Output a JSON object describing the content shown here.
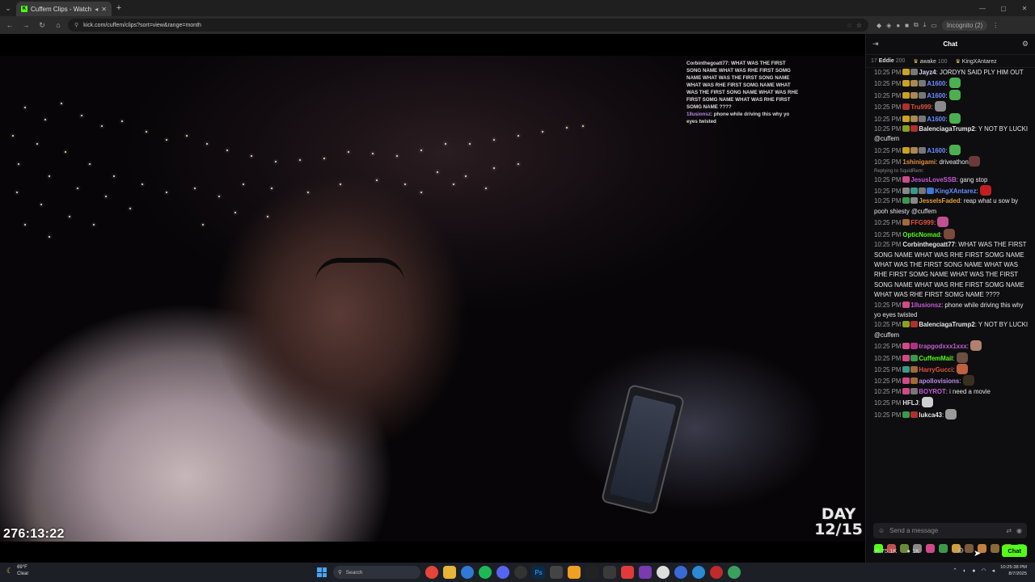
{
  "browser": {
    "tab_title": "Cuffem Clips - Watch Live ...",
    "new_tab": "+",
    "url": "kick.com/cuffem/clips?sort=view&range=month",
    "incognito_label": "Incognito (2)"
  },
  "video": {
    "overlay_chat": [
      {
        "user": "Corbinthegoatt77",
        "text": "WHAT WAS THE FIRST SONG NAME WHAT WAS RHE FIRST SOMG NAME WHAT WAS THE FIRST SONG NAME WHAT WAS RHE FIRST SOMG NAME WHAT WAS THE FIRST SONG NAME WHAT WAS RHE FIRST SOMG NAME WHAT WAS RHE FIRST SOMG NAME ????"
      },
      {
        "user": "1llusionsz",
        "text": "phone while driving this why yo eyes twisted"
      }
    ],
    "timer": "276:13:22",
    "day_line1": "DAY",
    "day_line2": "12/15"
  },
  "chat": {
    "header_title": "Chat",
    "leaderboard": [
      {
        "prefix": "17",
        "name": "Eddie",
        "amount": "200"
      },
      {
        "name": "awake",
        "amount": "100"
      },
      {
        "name": "KingXAntarez",
        "amount": ""
      }
    ],
    "messages": [
      {
        "time": "10:25 PM",
        "user": "Jayz4",
        "color": "#d9d1f0",
        "text": "JORDYN SAID PLY HIM OUT",
        "badges": [
          "#c9a227",
          "#777"
        ],
        "emote": null
      },
      {
        "time": "10:25 PM",
        "user": "A1600",
        "color": "#6a8cff",
        "text": "",
        "badges": [
          "#c9a227",
          "#aa8855",
          "#777"
        ],
        "emote": "#4caf50"
      },
      {
        "time": "10:25 PM",
        "user": "A1600",
        "color": "#6a8cff",
        "text": "",
        "badges": [
          "#c9a227",
          "#aa8855",
          "#777"
        ],
        "emote": "#4caf50"
      },
      {
        "time": "10:25 PM",
        "user": "Tru999",
        "color": "#e0533b",
        "text": "",
        "badges": [
          "#b03030"
        ],
        "emote": "#8a8a8a"
      },
      {
        "time": "10:25 PM",
        "user": "A1600",
        "color": "#6a8cff",
        "text": "",
        "badges": [
          "#c9a227",
          "#aa8855",
          "#777"
        ],
        "emote": "#4caf50"
      },
      {
        "time": "10:25 PM",
        "user": "BalenciagaTrump2",
        "color": "#e7e7e7",
        "text": "Y NOT BY LUCKI @cuffem",
        "badges": [
          "#8aa020",
          "#b03030"
        ],
        "emote": null
      },
      {
        "time": "10:25 PM",
        "user": "A1600",
        "color": "#6a8cff",
        "text": "",
        "badges": [
          "#c9a227",
          "#aa8855",
          "#777"
        ],
        "emote": "#4caf50"
      },
      {
        "time": "10:25 PM",
        "user": "1shinigami",
        "color": "#e08a3b",
        "text": "driveathon",
        "badges": [],
        "emote": "#6a3a3a"
      },
      {
        "time": "10:25 PM",
        "user": "JesusLoveSSB",
        "color": "#c65bd6",
        "text": "gang stop",
        "badges": [
          "#d04a8a"
        ],
        "emote": null,
        "reply": "Replying to SquidRem:"
      },
      {
        "time": "10:25 PM",
        "user": "KingXAntarez",
        "color": "#6a8cff",
        "text": "",
        "badges": [
          "#888",
          "#3a9a8a",
          "#777",
          "#3a7ad6"
        ],
        "emote": "#c02020"
      },
      {
        "time": "10:25 PM",
        "user": "JesseIsFaded",
        "color": "#e0a03b",
        "text": "reap what u sow by pooh shiesty @cuffem",
        "badges": [
          "#3a9a4a",
          "#888"
        ],
        "emote": null
      },
      {
        "time": "10:25 PM",
        "user": "FFG999",
        "color": "#e0533b",
        "text": "",
        "badges": [
          "#a06a3a"
        ],
        "emote": "#c05090"
      },
      {
        "time": "10:25 PM",
        "user": "OpticNomad",
        "color": "#53fc18",
        "text": "",
        "badges": [],
        "emote": "#7a4a3a"
      },
      {
        "time": "10:25 PM",
        "user": "Corbinthegoatt77",
        "color": "#e7e7e7",
        "text": "WHAT WAS THE FIRST SONG NAME WHAT WAS RHE FIRST SOMG NAME WHAT WAS THE FIRST SONG NAME WHAT WAS RHE FIRST SOMG NAME WHAT WAS THE FIRST SONG NAME WHAT WAS RHE FIRST SOMG NAME WHAT WAS RHE FIRST SOMG NAME ????",
        "badges": [],
        "emote": null
      },
      {
        "time": "10:25 PM",
        "user": "1llusionsz",
        "color": "#c65bd6",
        "text": "phone while driving this why yo eyes twisted",
        "badges": [
          "#d04a8a"
        ],
        "emote": null
      },
      {
        "time": "10:25 PM",
        "user": "BalenciagaTrump2",
        "color": "#e7e7e7",
        "text": "Y NOT BY LUCKI @cuffem",
        "badges": [
          "#8aa020",
          "#b03030"
        ],
        "emote": null
      },
      {
        "time": "10:25 PM",
        "user": "trapgodxxx1xxx",
        "color": "#c65bd6",
        "text": "",
        "badges": [
          "#d04a8a",
          "#b03080"
        ],
        "emote": "#b08070"
      },
      {
        "time": "10:25 PM",
        "user": "CuffemMail",
        "color": "#53fc18",
        "text": "",
        "badges": [
          "#d04a8a",
          "#3a9a4a"
        ],
        "emote": "#6a5040"
      },
      {
        "time": "10:25 PM",
        "user": "HarryGucci",
        "color": "#e0533b",
        "text": "",
        "badges": [
          "#3a9a8a",
          "#a06a3a"
        ],
        "emote": "#c06040"
      },
      {
        "time": "10:25 PM",
        "user": "apollovisions",
        "color": "#b98be8",
        "text": "",
        "badges": [
          "#d04a8a",
          "#a06a3a"
        ],
        "emote": "#3a3020"
      },
      {
        "time": "10:25 PM",
        "user": "BOYROT",
        "color": "#c65bd6",
        "text": "i need a movie",
        "badges": [
          "#d04a8a",
          "#777"
        ],
        "emote": null
      },
      {
        "time": "10:25 PM",
        "user": "HFLJ",
        "color": "#e7e7e7",
        "text": "",
        "badges": [],
        "emote": "#cfcfcf"
      },
      {
        "time": "10:25 PM",
        "user": "lukca43",
        "color": "#e7e7e7",
        "text": "",
        "badges": [
          "#3a9a4a",
          "#b03030"
        ],
        "emote": "#9a9a9a"
      }
    ],
    "input_placeholder": "Send a message",
    "viewers": "75.1K",
    "followers": "1K",
    "send_label": "Chat"
  },
  "taskbar": {
    "weather_temp": "69°F",
    "weather_desc": "Clear",
    "search_placeholder": "Search",
    "time": "10:25:38 PM",
    "date": "8/7/2025"
  }
}
